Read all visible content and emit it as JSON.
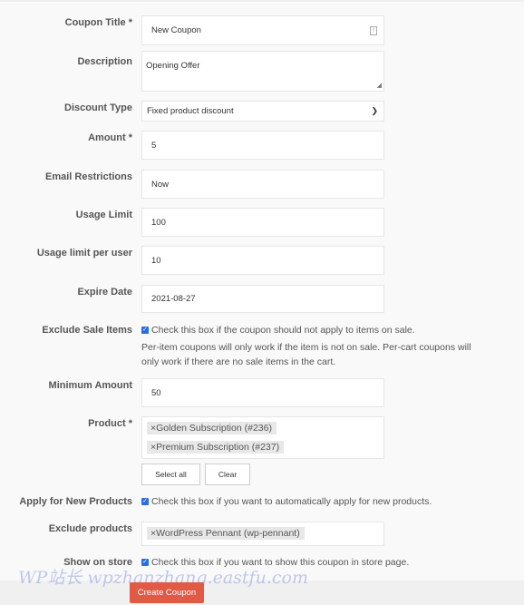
{
  "form": {
    "coupon_title": {
      "label": "Coupon Title *",
      "value": "New Coupon"
    },
    "description": {
      "label": "Description",
      "value": "Opening Offer"
    },
    "discount_type": {
      "label": "Discount Type",
      "value": "Fixed product discount"
    },
    "amount": {
      "label": "Amount *",
      "value": "5"
    },
    "email_restrictions": {
      "label": "Email Restrictions",
      "value": "Now"
    },
    "usage_limit": {
      "label": "Usage Limit",
      "value": "100"
    },
    "usage_limit_per_user": {
      "label": "Usage limit per user",
      "value": "10"
    },
    "expire_date": {
      "label": "Expire Date",
      "value": "2021-08-27"
    },
    "exclude_sale_items": {
      "label": "Exclude Sale Items",
      "checked": true,
      "text": "Check this box if the coupon should not apply to items on sale.",
      "help1": "Per-item coupons will only work if the item is not on sale. Per-cart coupons will",
      "help2": "only work if there are no sale items in the cart."
    },
    "minimum_amount": {
      "label": "Minimum Amount",
      "value": "50"
    },
    "product": {
      "label": "Product *",
      "tags": [
        "Golden Subscription (#236)",
        "Premium Subscription (#237)"
      ],
      "select_all": "Select all",
      "clear": "Clear"
    },
    "apply_new_products": {
      "label": "Apply for New Products",
      "checked": true,
      "text": "Check this box if you want to automatically apply for new products."
    },
    "exclude_products": {
      "label": "Exclude products",
      "tags": [
        "WordPress Pennant (wp-pennant)"
      ]
    },
    "show_on_store": {
      "label": "Show on store",
      "checked": true,
      "text": "Check this box if you want to show this coupon in store page."
    },
    "submit": "Create Coupon"
  },
  "tag_remove_glyph": "×",
  "watermark": "WP站长 wpzhanzhang.eastfu.com",
  "colors": {
    "accent": "#e15a45",
    "checkbox": "#2b6ee0"
  }
}
